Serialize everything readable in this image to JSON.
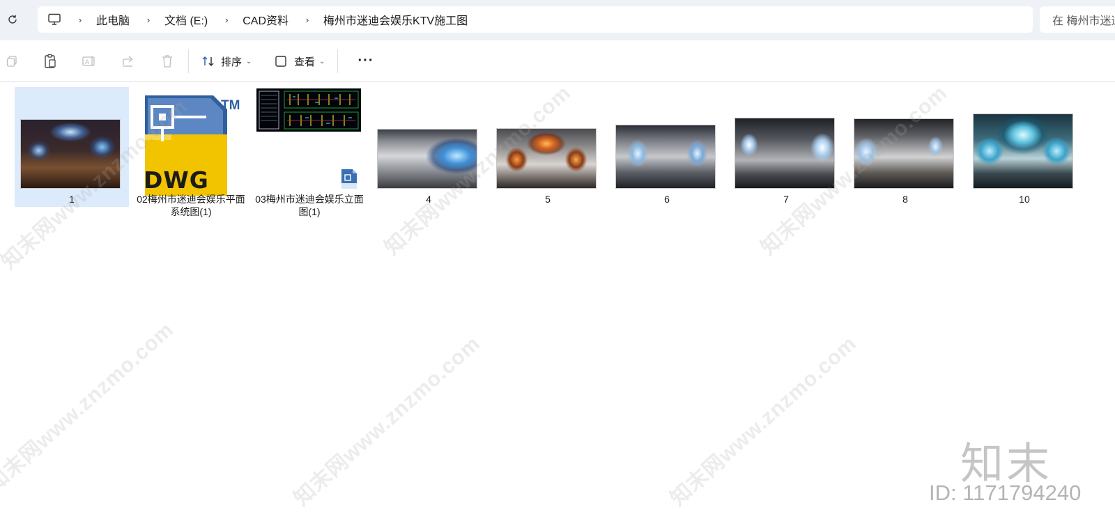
{
  "address_bar": {
    "breadcrumbs": [
      "此电脑",
      "文档 (E:)",
      "CAD资料",
      "梅州市迷迪会娱乐KTV施工图"
    ],
    "search_placeholder": "在 梅州市迷迪"
  },
  "toolbar": {
    "sort_label": "排序",
    "view_label": "查看",
    "more_label": "···",
    "icons": [
      "copy-icon",
      "paste-icon",
      "rename-icon",
      "share-icon",
      "delete-icon",
      "sort-icon",
      "view-icon",
      "more-icon"
    ]
  },
  "files": [
    {
      "name": "1",
      "type": "image",
      "selected": true
    },
    {
      "name": "02梅州市迷迪会娱乐平面系统图(1)",
      "type": "dwg",
      "badge": "DWG",
      "trademark": "TM"
    },
    {
      "name": "03梅州市迷迪会娱乐立面图(1)",
      "type": "dwg-preview"
    },
    {
      "name": "4",
      "type": "image"
    },
    {
      "name": "5",
      "type": "image"
    },
    {
      "name": "6",
      "type": "image"
    },
    {
      "name": "7",
      "type": "image"
    },
    {
      "name": "8",
      "type": "image"
    },
    {
      "name": "10",
      "type": "image"
    }
  ],
  "watermark": {
    "text": "知末网www.znzmo.com",
    "brand": "知末",
    "id_text": "ID: 1171794240"
  },
  "colors": {
    "selection": "#dcebfc",
    "address_background": "#eef1f6",
    "dwg_yellow": "#f2c400",
    "dwg_blue": "#2e5f9e"
  }
}
